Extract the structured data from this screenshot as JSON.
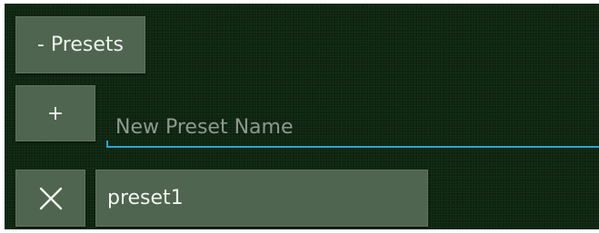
{
  "presets_toggle": {
    "label": "- Presets"
  },
  "add_preset": {
    "label": "+"
  },
  "new_preset_input": {
    "placeholder": "New Preset Name",
    "value": ""
  },
  "presets": [
    {
      "name": "preset1",
      "delete_icon": "close-icon"
    }
  ],
  "colors": {
    "panel_background": "#0e240f",
    "button_background": "#4f654f",
    "input_underline": "#2aa5d6",
    "text": "#eef2ee",
    "placeholder": "#8d9a8d"
  }
}
